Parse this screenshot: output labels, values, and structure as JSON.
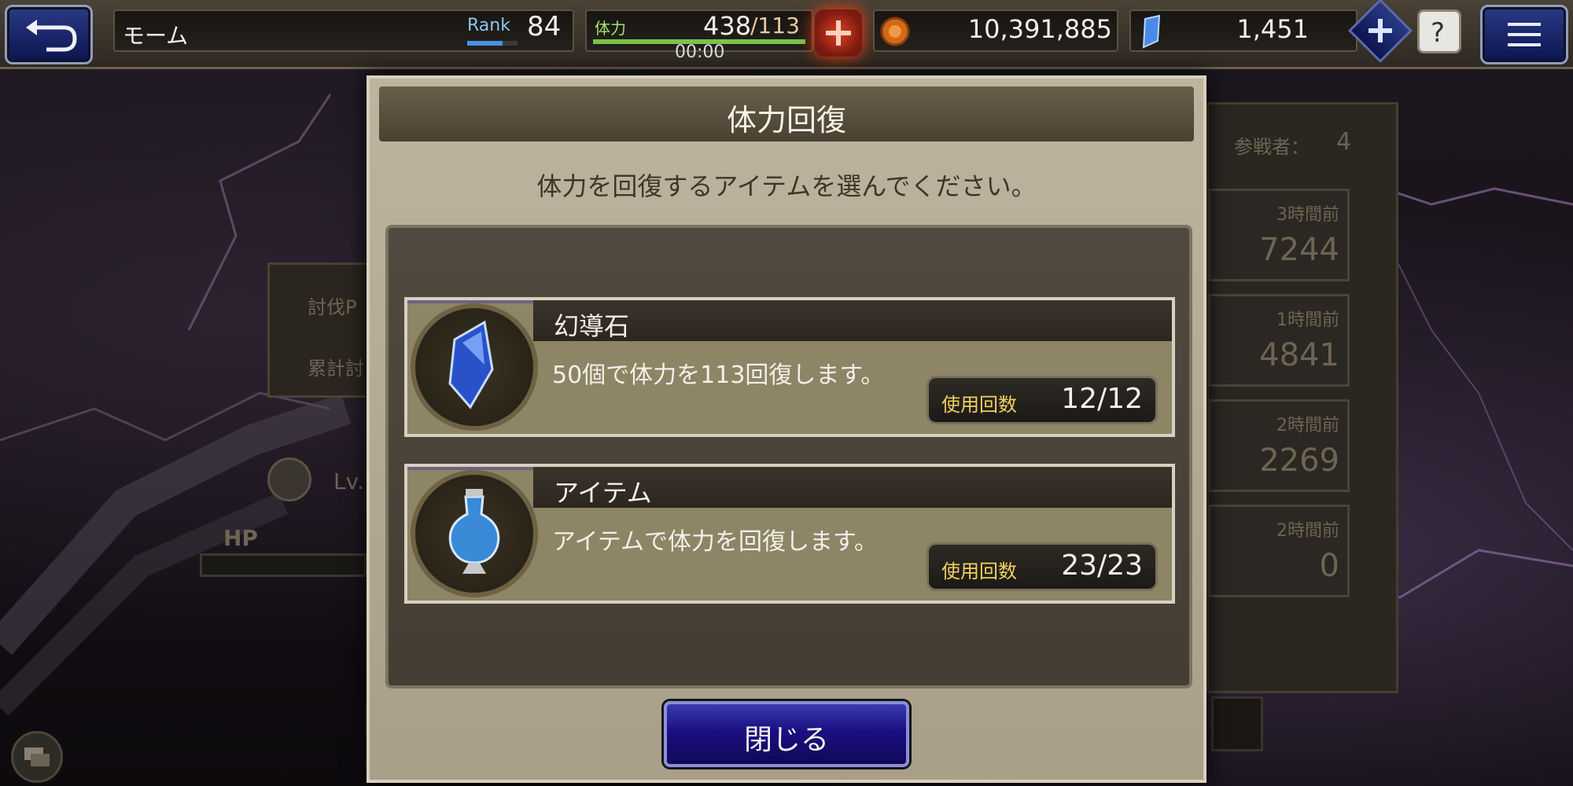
{
  "header": {
    "player_name": "モーム",
    "rank_label": "Rank",
    "rank_value": "84",
    "stamina_label": "体力",
    "stamina_current": "438",
    "stamina_max": "/113",
    "stamina_timer": "00:00",
    "gil": "10,391,885",
    "gems": "1,451"
  },
  "dialog": {
    "title": "体力回復",
    "subtitle": "体力を回復するアイテムを選んでください。",
    "items": [
      {
        "name": "幻導石",
        "desc": "50個で体力を113回復します。",
        "count_label": "使用回数",
        "count": "12/12",
        "icon": "crystal-icon"
      },
      {
        "name": "アイテム",
        "desc": "アイテムで体力を回復します。",
        "count_label": "使用回数",
        "count": "23/23",
        "icon": "potion-icon"
      }
    ],
    "close_label": "閉じる"
  },
  "background": {
    "participants_label": "参戦者：",
    "participants": "4",
    "left_labels": [
      "討伐P",
      "累計討"
    ],
    "level_prefix": "Lv.",
    "hp_label": "HP",
    "history": [
      {
        "time": "3時間前",
        "value": "7244"
      },
      {
        "time": "1時間前",
        "value": "4841"
      },
      {
        "time": "2時間前",
        "value": "2269"
      },
      {
        "time": "2時間前",
        "value": "0"
      }
    ]
  },
  "colors": {
    "accent_blue": "#1a0f80",
    "panel_tan": "#b3a993",
    "stamina_green": "#7ac24a"
  }
}
